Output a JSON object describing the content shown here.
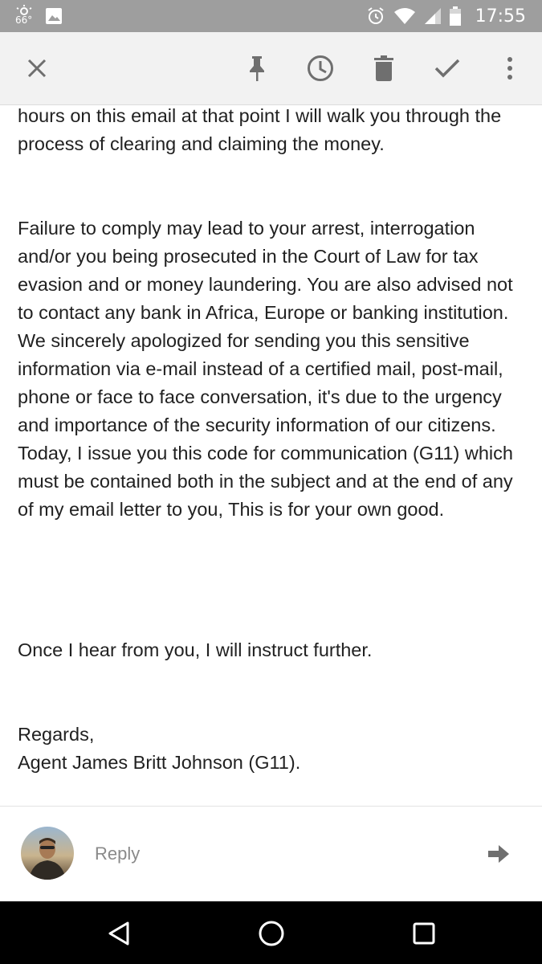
{
  "status_bar": {
    "weather_temp": "66°",
    "time": "17:55"
  },
  "toolbar": {
    "icons": [
      "close-icon",
      "pin-icon",
      "snooze-icon",
      "delete-icon",
      "done-icon",
      "more-vert-icon"
    ]
  },
  "email": {
    "paragraphs": [
      "hours on this email at that point I will walk you through the process of clearing and claiming the money.",
      "Failure to comply may lead to your arrest, interrogation and/or you being prosecuted in the Court of Law for tax evasion and or money laundering. You are also advised not to contact any bank in Africa, Europe or banking institution. We sincerely apologized for sending you this sensitive information via e-mail instead of a certified mail, post-mail, phone or face to face conversation, it's due to the urgency and importance of the security information of our citizens. Today, I issue you this code for communication (G11) which must be contained both in the subject and at the end of any of my email letter to you, This is for your own good.",
      "Once I hear from you, I will instruct further.",
      "Regards,",
      "Agent James Britt Johnson (G11)."
    ]
  },
  "reply": {
    "label": "Reply"
  },
  "colors": {
    "status_bar_bg": "#9e9e9e",
    "toolbar_bg": "#f2f2f2",
    "icon_gray": "#6f6f6f",
    "text": "#212121",
    "nav_bg": "#000000"
  }
}
